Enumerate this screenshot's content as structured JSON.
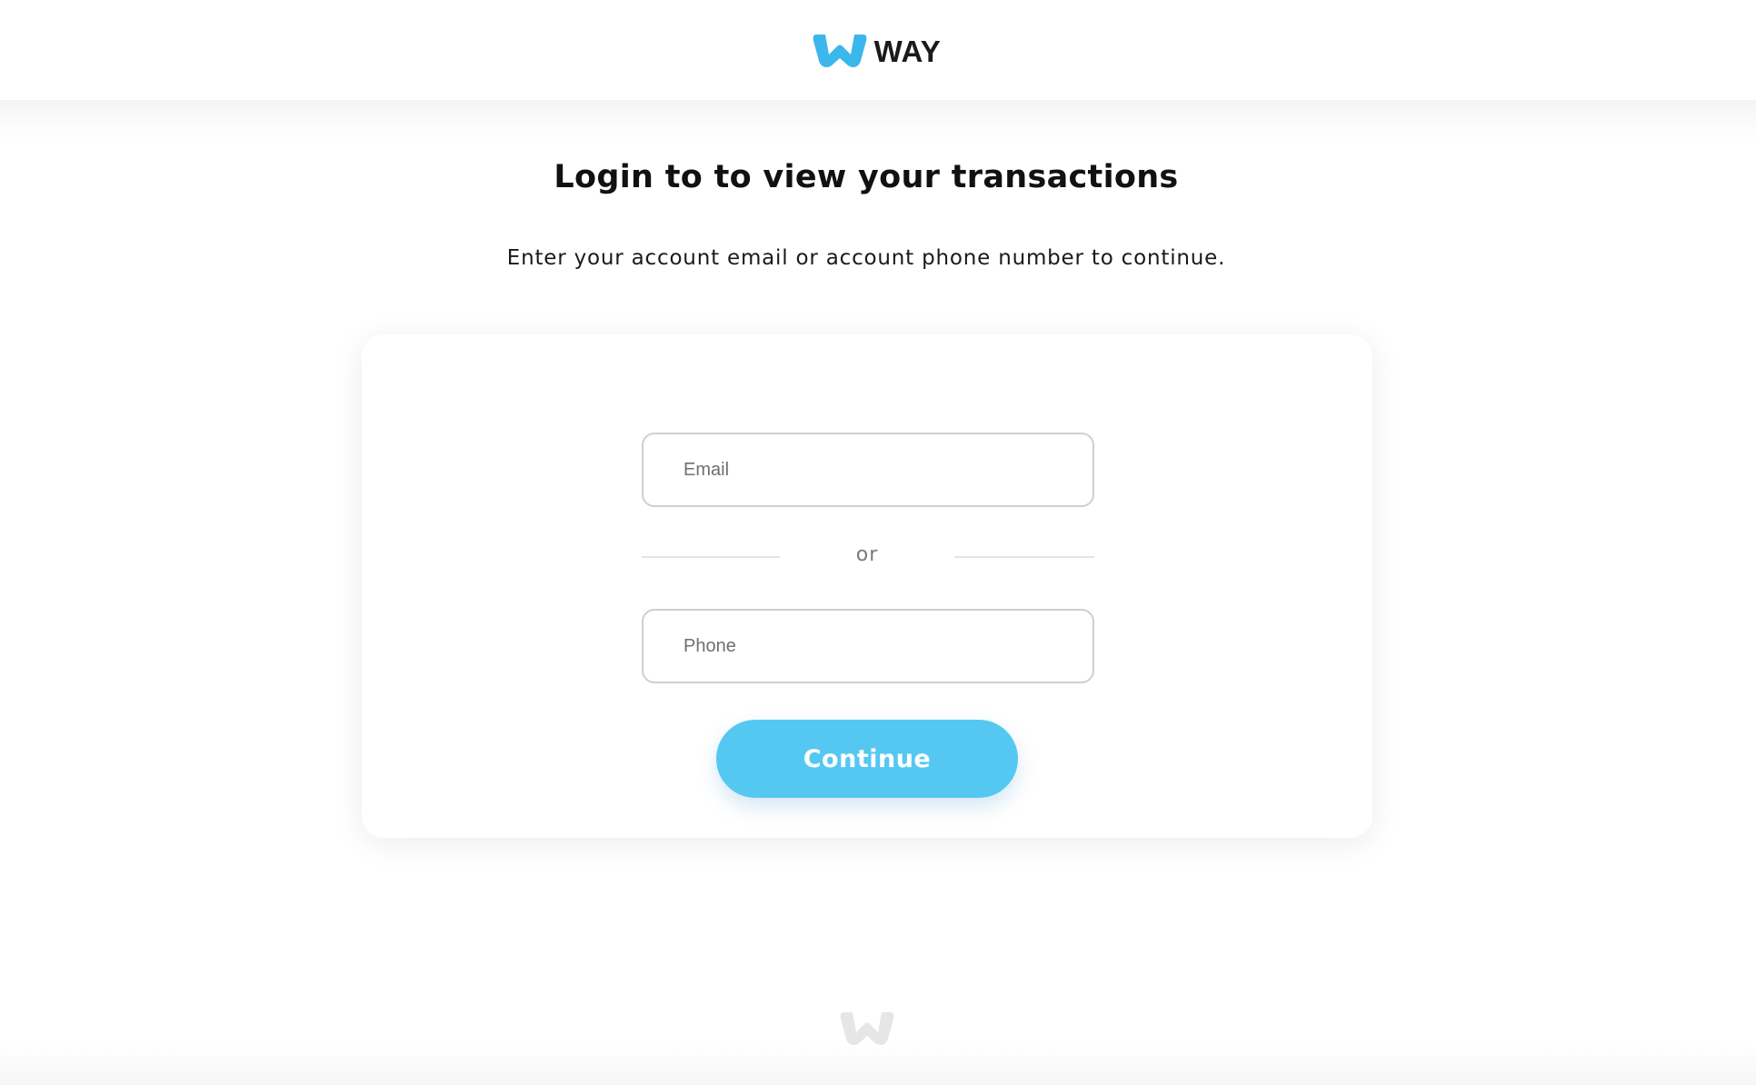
{
  "header": {
    "brand_name": "WAY",
    "logo_icon": "way-w-logo",
    "brand_color": "#3bb7ec"
  },
  "main": {
    "title": "Login to to view your transactions",
    "subtitle": "Enter your account email or account phone number to continue."
  },
  "form": {
    "email_placeholder": "Email",
    "email_value": "",
    "divider_label": "or",
    "phone_placeholder": "Phone",
    "phone_value": "",
    "continue_label": "Continue",
    "button_color": "#55c8f2"
  },
  "footer": {
    "logo_icon": "way-w-logo-muted",
    "logo_color": "#e6e6e6"
  }
}
